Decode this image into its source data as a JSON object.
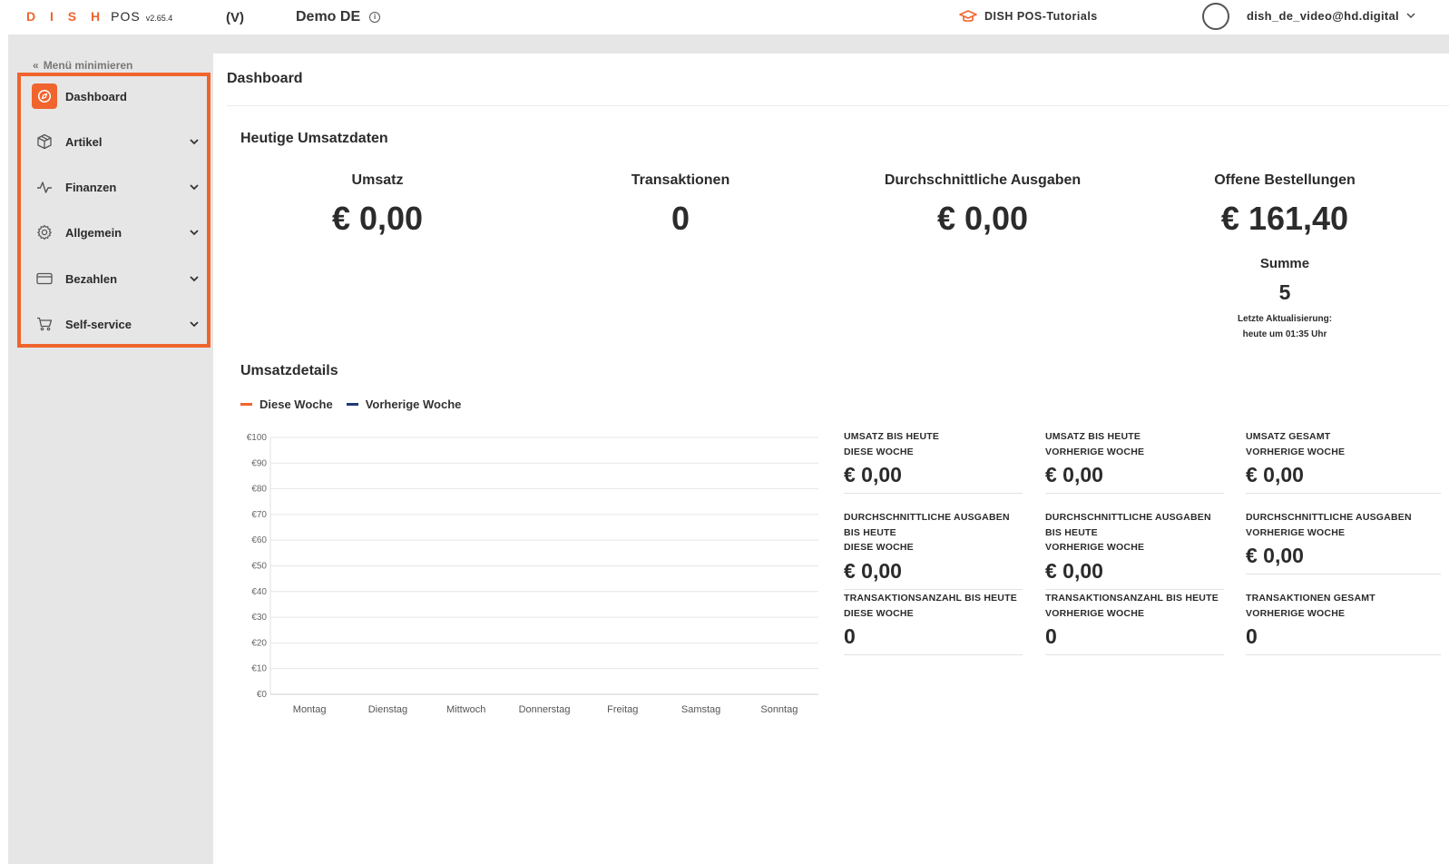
{
  "header": {
    "brand": "D I S H",
    "product": "POS",
    "version": "v2.65.4",
    "mode": "(V)",
    "store": "Demo DE",
    "tutorials": "DISH POS-Tutorials",
    "user": "dish_de_video@hd.digital"
  },
  "sidebar": {
    "minimize_label": "Menü minimieren",
    "items": [
      {
        "label": "Dashboard",
        "icon": "compass-icon",
        "active": true
      },
      {
        "label": "Artikel",
        "icon": "box-icon"
      },
      {
        "label": "Finanzen",
        "icon": "activity-icon"
      },
      {
        "label": "Allgemein",
        "icon": "gear-icon"
      },
      {
        "label": "Bezahlen",
        "icon": "credit-card-icon"
      },
      {
        "label": "Self-service",
        "icon": "cart-icon"
      }
    ]
  },
  "main": {
    "title": "Dashboard",
    "today_title": "Heutige Umsatzdaten",
    "kpis": [
      {
        "label": "Umsatz",
        "value": "€ 0,00"
      },
      {
        "label": "Transaktionen",
        "value": "0"
      },
      {
        "label": "Durchschnittliche Ausgaben",
        "value": "€ 0,00"
      },
      {
        "label": "Offene Bestellungen",
        "value": "€ 161,40"
      }
    ],
    "open_orders": {
      "sum_label": "Summe",
      "sum_value": "5",
      "update_line1": "Letzte Aktualisierung:",
      "update_line2": "heute um 01:35 Uhr"
    },
    "details_title": "Umsatzdetails",
    "legend": [
      {
        "label": "Diese Woche",
        "color": "#f0642d"
      },
      {
        "label": "Vorherige Woche",
        "color": "#1f3a7a"
      }
    ],
    "stats": [
      {
        "label": "UMSATZ BIS HEUTE\nDIESE WOCHE",
        "value": "€ 0,00"
      },
      {
        "label": "UMSATZ BIS HEUTE\nVORHERIGE WOCHE",
        "value": "€ 0,00"
      },
      {
        "label": "UMSATZ GESAMT\nVORHERIGE WOCHE",
        "value": "€ 0,00"
      },
      {
        "label": "DURCHSCHNITTLICHE AUSGABEN\nBIS HEUTE\nDIESE WOCHE",
        "value": "€ 0,00"
      },
      {
        "label": "DURCHSCHNITTLICHE AUSGABEN\nBIS HEUTE\nVORHERIGE WOCHE",
        "value": "€ 0,00"
      },
      {
        "label": "DURCHSCHNITTLICHE AUSGABEN\nVORHERIGE WOCHE",
        "value": "€ 0,00"
      },
      {
        "label": "TRANSAKTIONSANZAHL BIS HEUTE\nDIESE WOCHE",
        "value": "0"
      },
      {
        "label": "TRANSAKTIONSANZAHL BIS HEUTE\nVORHERIGE WOCHE",
        "value": "0"
      },
      {
        "label": "TRANSAKTIONEN GESAMT\nVORHERIGE WOCHE",
        "value": "0"
      }
    ]
  },
  "chart_data": {
    "type": "line",
    "categories": [
      "Montag",
      "Dienstag",
      "Mittwoch",
      "Donnerstag",
      "Freitag",
      "Samstag",
      "Sonntag"
    ],
    "y_ticks": [
      "€0",
      "€10",
      "€20",
      "€30",
      "€40",
      "€50",
      "€60",
      "€70",
      "€80",
      "€90",
      "€100"
    ],
    "ylim": [
      0,
      100
    ],
    "grid": true,
    "series": [
      {
        "name": "Diese Woche",
        "values": [],
        "color": "#f0642d"
      },
      {
        "name": "Vorherige Woche",
        "values": [],
        "color": "#1f3a7a"
      }
    ]
  }
}
